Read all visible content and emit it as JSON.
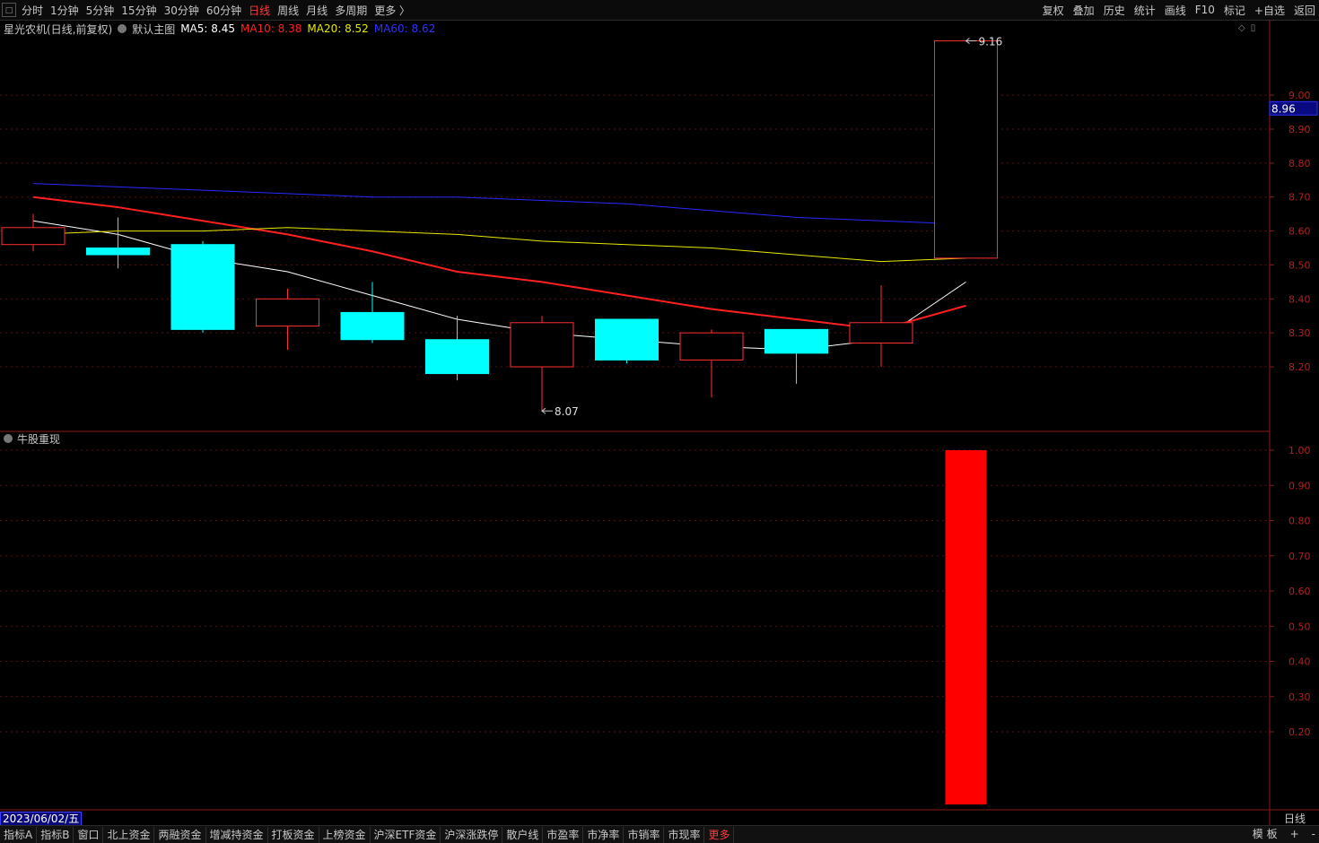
{
  "toolbar": {
    "window_icon": "□",
    "periods": [
      "分时",
      "1分钟",
      "5分钟",
      "15分钟",
      "30分钟",
      "60分钟",
      "日线",
      "周线",
      "月线",
      "多周期",
      "更多 〉"
    ],
    "active_period": "日线",
    "right": [
      "复权",
      "叠加",
      "历史",
      "统计",
      "画线",
      "F10",
      "标记",
      "+自选",
      "返回"
    ]
  },
  "legend": {
    "stock": "星光农机(日线,前复权)",
    "template": "默认主图",
    "ma5": "MA5: 8.45",
    "ma10": "MA10: 8.38",
    "ma20": "MA20: 8.52",
    "ma60": "MA60: 8.62",
    "colors": {
      "ma5": "#ffffff",
      "ma10": "#ff2020",
      "ma20": "#e8e800",
      "ma60": "#2020ff"
    }
  },
  "indicator": {
    "name": "牛股重现"
  },
  "date_label": "2023/06/02/五",
  "period_tag": "日线",
  "bottom_tabs": [
    "指标A",
    "指标B",
    "窗口",
    "北上资金",
    "两融资金",
    "增减持资金",
    "打板资金",
    "上榜资金",
    "沪深ETF资金",
    "沪深涨跌停",
    "散户线",
    "市盈率",
    "市净率",
    "市销率",
    "市现率",
    "更多"
  ],
  "bottom_highlight": "更多",
  "bottom_right": [
    "模 板",
    "+",
    "-"
  ],
  "chart_data": [
    {
      "type": "candlestick",
      "title": "星光农机(日线,前复权)",
      "y_ticks": [
        8.2,
        8.3,
        8.4,
        8.5,
        8.6,
        8.7,
        8.8,
        8.9,
        9.0
      ],
      "current_price_label": "8.96",
      "ylim": [
        8.07,
        9.16
      ],
      "colors": {
        "up": "#ff3030",
        "down": "#00ffff"
      },
      "candles": [
        {
          "open": 8.56,
          "close": 8.61,
          "high": 8.65,
          "low": 8.54
        },
        {
          "open": 8.55,
          "close": 8.53,
          "high": 8.64,
          "low": 8.49
        },
        {
          "open": 8.56,
          "close": 8.31,
          "high": 8.57,
          "low": 8.3
        },
        {
          "open": 8.32,
          "close": 8.4,
          "high": 8.43,
          "low": 8.25
        },
        {
          "open": 8.36,
          "close": 8.28,
          "high": 8.45,
          "low": 8.27
        },
        {
          "open": 8.28,
          "close": 8.18,
          "high": 8.35,
          "low": 8.16
        },
        {
          "open": 8.2,
          "close": 8.33,
          "high": 8.35,
          "low": 8.07
        },
        {
          "open": 8.34,
          "close": 8.22,
          "high": 8.34,
          "low": 8.21
        },
        {
          "open": 8.22,
          "close": 8.3,
          "high": 8.31,
          "low": 8.11
        },
        {
          "open": 8.31,
          "close": 8.24,
          "high": 8.31,
          "low": 8.15
        },
        {
          "open": 8.27,
          "close": 8.33,
          "high": 8.44,
          "low": 8.2
        },
        {
          "open": 8.52,
          "close": 9.16,
          "high": 9.16,
          "low": 8.52
        }
      ],
      "annotations": [
        {
          "label": "8.07",
          "value": 8.07,
          "index": 6
        },
        {
          "label": "9.16",
          "value": 9.16,
          "index": 11
        }
      ],
      "series": [
        {
          "name": "MA5",
          "values": [
            8.63,
            8.59,
            8.52,
            8.48,
            8.41,
            8.34,
            8.3,
            8.28,
            8.26,
            8.25,
            8.28,
            8.45
          ]
        },
        {
          "name": "MA10",
          "values": [
            8.7,
            8.67,
            8.63,
            8.59,
            8.54,
            8.48,
            8.45,
            8.41,
            8.37,
            8.34,
            8.31,
            8.38
          ]
        },
        {
          "name": "MA20",
          "values": [
            8.59,
            8.6,
            8.6,
            8.61,
            8.6,
            8.59,
            8.57,
            8.56,
            8.55,
            8.53,
            8.51,
            8.52
          ]
        },
        {
          "name": "MA60",
          "values": [
            8.74,
            8.73,
            8.72,
            8.71,
            8.7,
            8.7,
            8.69,
            8.68,
            8.66,
            8.64,
            8.63,
            8.62
          ]
        }
      ]
    },
    {
      "type": "bar",
      "title": "牛股重现",
      "y_ticks": [
        0.2,
        0.3,
        0.4,
        0.5,
        0.6,
        0.7,
        0.8,
        0.9,
        1.0
      ],
      "ylim": [
        0,
        1
      ],
      "values": [
        0,
        0,
        0,
        0,
        0,
        0,
        0,
        0,
        0,
        0,
        0,
        1
      ],
      "color": "#ff0000"
    }
  ]
}
